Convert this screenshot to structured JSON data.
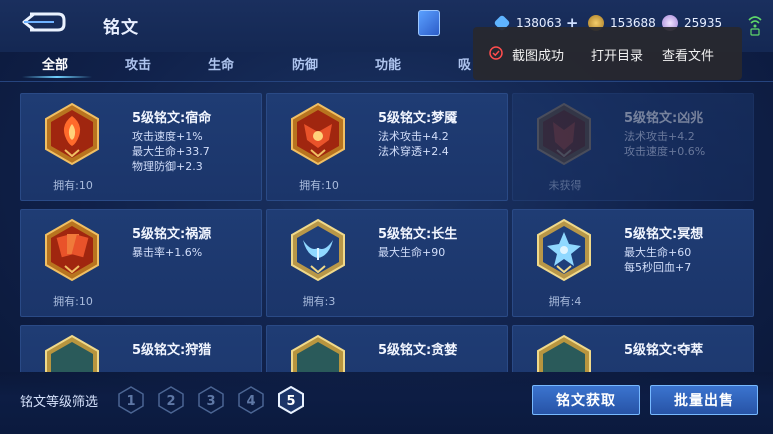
{
  "header": {
    "title": "铭文",
    "currencies": [
      {
        "icon": "diamond-icon",
        "value": "138063",
        "color": "#7ec7ff"
      },
      {
        "icon": "gold-coin-icon",
        "value": "153688",
        "color": "#d9a84b"
      },
      {
        "icon": "gem-icon",
        "value": "25935",
        "color": "#c9a8ff"
      }
    ],
    "add_glyph": "+"
  },
  "tabs": [
    {
      "label": "全部",
      "active": true
    },
    {
      "label": "攻击",
      "active": false
    },
    {
      "label": "生命",
      "active": false
    },
    {
      "label": "防御",
      "active": false
    },
    {
      "label": "功能",
      "active": false
    },
    {
      "label": "吸",
      "active": false
    }
  ],
  "toast": {
    "message": "截图成功",
    "open_folder": "打开目录",
    "view_file": "查看文件"
  },
  "runes": [
    {
      "name": "5级铭文:宿命",
      "attrs": [
        "攻击速度+1%",
        "最大生命+33.7",
        "物理防御+2.3"
      ],
      "owned": "拥有:10",
      "color": "red",
      "obtained": true
    },
    {
      "name": "5级铭文:梦魇",
      "attrs": [
        "法术攻击+4.2",
        "法术穿透+2.4"
      ],
      "owned": "拥有:10",
      "color": "red",
      "obtained": true
    },
    {
      "name": "5级铭文:凶兆",
      "attrs": [
        "法术攻击+4.2",
        "攻击速度+0.6%"
      ],
      "owned": "未获得",
      "color": "red",
      "obtained": false
    },
    {
      "name": "5级铭文:祸源",
      "attrs": [
        "暴击率+1.6%"
      ],
      "owned": "拥有:10",
      "color": "red",
      "obtained": true
    },
    {
      "name": "5级铭文:长生",
      "attrs": [
        "最大生命+90"
      ],
      "owned": "拥有:3",
      "color": "blue",
      "obtained": true
    },
    {
      "name": "5级铭文:冥想",
      "attrs": [
        "最大生命+60",
        "每5秒回血+7"
      ],
      "owned": "拥有:4",
      "color": "blue",
      "obtained": true
    },
    {
      "name": "5级铭文:狩猎",
      "attrs": [],
      "owned": "",
      "color": "green",
      "obtained": true
    },
    {
      "name": "5级铭文:贪婪",
      "attrs": [],
      "owned": "",
      "color": "green",
      "obtained": true
    },
    {
      "name": "5级铭文:夺萃",
      "attrs": [],
      "owned": "",
      "color": "green",
      "obtained": true
    }
  ],
  "footer": {
    "filter_label": "铭文等级筛选",
    "levels": [
      "1",
      "2",
      "3",
      "4",
      "5"
    ],
    "selected_level": "5",
    "obtain_button": "铭文获取",
    "sell_button": "批量出售"
  }
}
